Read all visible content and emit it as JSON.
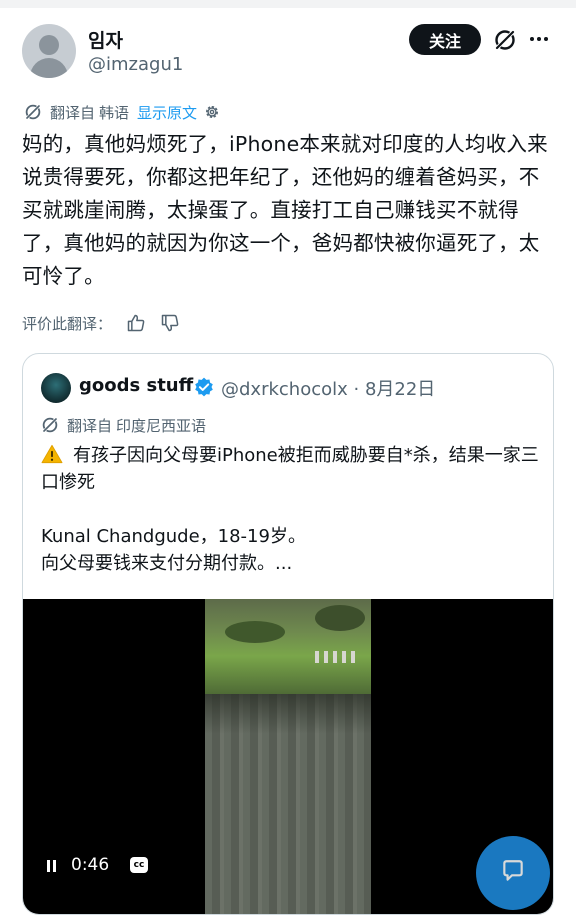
{
  "author": {
    "display_name": "임자",
    "handle": "@imzagu1",
    "follow_label": "关注"
  },
  "translation": {
    "label": "翻译自",
    "language": "韩语",
    "show_original": "显示原文"
  },
  "tweet": {
    "text": "妈的，真他妈烦死了，iPhone本来就对印度的人均收入来说贵得要死，你都这把年纪了，还他妈的缠着爸妈买，不买就跳崖闹腾，太操蛋了。直接打工自己赚钱买不就得了，真他妈的就因为你这一个，爸妈都快被你逼死了，太可怜了。"
  },
  "rate_translation": {
    "label": "评价此翻译："
  },
  "quote": {
    "display_name": "goods stuff",
    "handle_date": "@dxrkchocolx · 8月22日",
    "translation_label": "翻译自",
    "translation_language": "印度尼西亚语",
    "text_line1": "有孩子因向父母要iPhone被拒而威胁要自*杀，结果一家三口惨死",
    "text_line3": "Kunal Chandgude，18-19岁。",
    "text_line4": "向父母要钱来支付分期付款。...",
    "video": {
      "time": "0:46",
      "cc_label": "cc"
    }
  },
  "colors": {
    "accent": "#1d9bf0",
    "text_primary": "#0f1419",
    "text_secondary": "#536471",
    "border": "#cfd9de",
    "warning": "#f4b400"
  },
  "icons": [
    "grok-icon",
    "more-icon",
    "translate-icon",
    "settings-icon",
    "thumbs-up-icon",
    "thumbs-down-icon",
    "verified-icon",
    "warning-icon",
    "pause-icon",
    "cc-icon",
    "compose-icon"
  ]
}
